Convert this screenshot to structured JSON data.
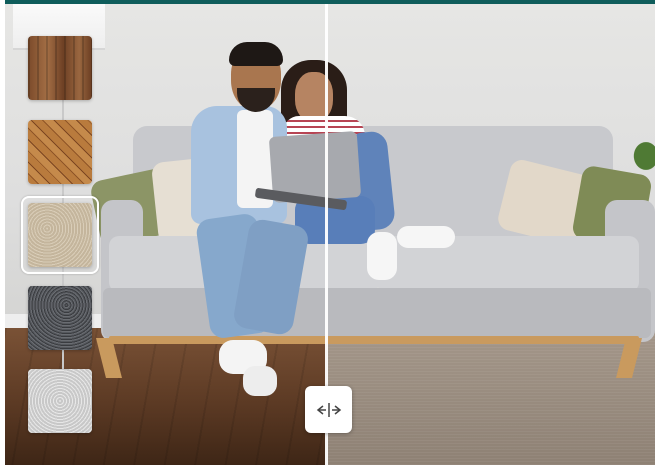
{
  "viewer": {
    "brand_color": "#0f5d5b",
    "swatches": [
      {
        "name": "dark-wood-plank",
        "selected": false
      },
      {
        "name": "herringbone-wood",
        "selected": false
      },
      {
        "name": "beige-carpet",
        "selected": true
      },
      {
        "name": "charcoal-carpet",
        "selected": false
      },
      {
        "name": "light-grey-carpet",
        "selected": false
      }
    ],
    "compare_handle_icon": "split-compare-icon",
    "compare_split": 0.5
  }
}
